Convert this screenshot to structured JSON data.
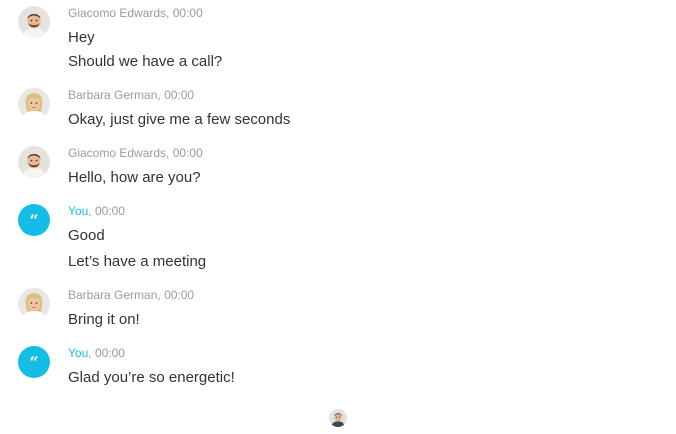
{
  "messages": [
    {
      "sender": "Giacomo Edwards",
      "time": "00:00",
      "lines": [
        "Hey",
        "Should we have a call?"
      ]
    },
    {
      "sender": "Barbara German",
      "time": "00:00",
      "lines": [
        "Okay, just give me a few seconds"
      ]
    },
    {
      "sender": "Giacomo Edwards",
      "time": "00:00",
      "lines": [
        "Hello, how are you?"
      ]
    },
    {
      "sender": "You",
      "time": "00:00",
      "lines": [
        "Good",
        "Let’s have a meeting"
      ]
    },
    {
      "sender": "Barbara German",
      "time": "00:00",
      "lines": [
        "Bring it on!"
      ]
    },
    {
      "sender": "You",
      "time": "00:00",
      "lines": [
        "Glad you’re so energetic!"
      ]
    }
  ],
  "separator": ",",
  "you_avatar_glyph": "“",
  "colors": {
    "accent": "#14bde6",
    "meta_text": "#9a9a9a",
    "message_text": "#333333"
  },
  "icons": {
    "you_avatar": "quote-icon",
    "male_avatar": "man-avatar",
    "female_avatar": "woman-avatar",
    "typing_indicator": "man-avatar"
  }
}
